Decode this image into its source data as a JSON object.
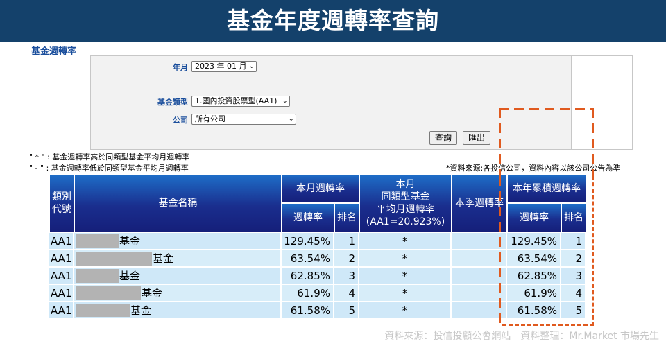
{
  "banner": {
    "title": "基金年度週轉率查詢"
  },
  "section": {
    "title": "基金週轉率"
  },
  "form": {
    "year_month_label": "年月",
    "year_month_value": "2023 年 01 月",
    "fund_type_label": "基金類型",
    "fund_type_value": "1.國內投資股票型(AA1)",
    "company_label": "公司",
    "company_value": "所有公司",
    "query_button": "查詢",
    "export_button": "匯出"
  },
  "notes": {
    "note1": "\" * \" : 基金週轉率高於同類型基金平均月週轉率",
    "note2": "\" - \" : 基金週轉率低於同類型基金平均月週轉率",
    "source": "*資料來源:各投信公司，資料內容以該公司公告為準"
  },
  "table": {
    "headers": {
      "category_code": "類別代號",
      "fund_name": "基金名稱",
      "monthly_turnover": "本月週轉率",
      "turnover_rate": "週轉率",
      "rank": "排名",
      "same_type_avg": "本月\n同類型基金\n平均月週轉率\n(AA1=20.923%)",
      "quarter_turnover": "本季週轉率",
      "ytd_turnover": "本年累積週轉率",
      "ytd_rate": "週轉率",
      "ytd_rank": "排名"
    },
    "rows": [
      {
        "code": "AA1",
        "name_suffix": "基金",
        "rate": "129.45%",
        "rank": "1",
        "avg": "*",
        "quarter": "",
        "ytd_rate": "129.45%",
        "ytd_rank": "1"
      },
      {
        "code": "AA1",
        "name_suffix": "基金",
        "rate": "63.54%",
        "rank": "2",
        "avg": "*",
        "quarter": "",
        "ytd_rate": "63.54%",
        "ytd_rank": "2"
      },
      {
        "code": "AA1",
        "name_suffix": "基金",
        "rate": "62.85%",
        "rank": "3",
        "avg": "*",
        "quarter": "",
        "ytd_rate": "62.85%",
        "ytd_rank": "3"
      },
      {
        "code": "AA1",
        "name_suffix": "基金",
        "rate": "61.9%",
        "rank": "4",
        "avg": "*",
        "quarter": "",
        "ytd_rate": "61.9%",
        "ytd_rank": "4"
      },
      {
        "code": "AA1",
        "name_suffix": "基金",
        "rate": "61.58%",
        "rank": "5",
        "avg": "*",
        "quarter": "",
        "ytd_rate": "61.58%",
        "ytd_rank": "5"
      }
    ]
  },
  "footer": {
    "credit": "資料來源：投信投顧公會網站　資料整理：Mr.Market 市場先生"
  },
  "colors": {
    "banner": "#14416b",
    "header_blue": "#1a2e8e",
    "row_bg": "#cfe8f8",
    "highlight": "#e05a1f"
  }
}
